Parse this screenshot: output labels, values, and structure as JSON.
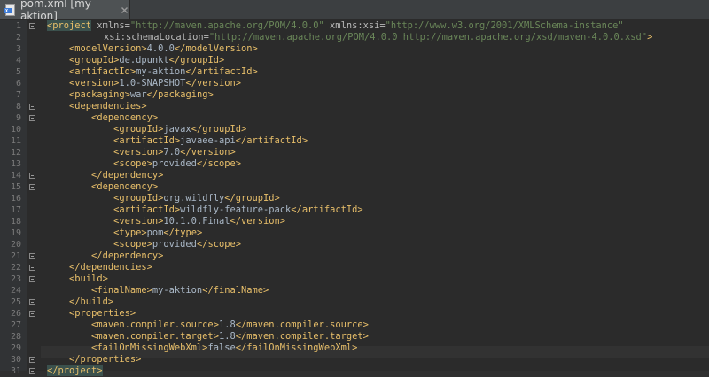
{
  "tab": {
    "title": "pom.xml [my-aktion]",
    "icon": "xml-file-icon"
  },
  "project_open": "<project",
  "project_close": "</project>",
  "xmlns_attr": " xmlns=",
  "xmlns_val": "\"http://maven.apache.org/POM/4.0.0\"",
  "xsi_attr": " xmlns:xsi=",
  "xsi_val": "\"http://www.w3.org/2001/XMLSchema-instance\"",
  "loc_attr": "xsi:schemaLocation=",
  "loc_val": "\"http://maven.apache.org/POM/4.0.0 http://maven.apache.org/xsd/maven-4.0.0.xsd\"",
  "line_numbers": [
    "1",
    "2",
    "3",
    "4",
    "5",
    "6",
    "7",
    "8",
    "9",
    "10",
    "11",
    "12",
    "13",
    "14",
    "15",
    "16",
    "17",
    "18",
    "19",
    "20",
    "21",
    "22",
    "23",
    "24",
    "25",
    "26",
    "27",
    "28",
    "29",
    "30",
    "31"
  ],
  "lines": [
    null,
    null,
    [
      "    ",
      "modelVersion",
      "4.0.0"
    ],
    [
      "    ",
      "groupId",
      "de.dpunkt"
    ],
    [
      "    ",
      "artifactId",
      "my-aktion"
    ],
    [
      "    ",
      "version",
      "1.0-SNAPSHOT"
    ],
    [
      "    ",
      "packaging",
      "war"
    ],
    [
      "    ",
      "dependencies",
      null,
      "open"
    ],
    [
      "        ",
      "dependency",
      null,
      "open"
    ],
    [
      "            ",
      "groupId",
      "javax"
    ],
    [
      "            ",
      "artifactId",
      "javaee-api"
    ],
    [
      "            ",
      "version",
      "7.0"
    ],
    [
      "            ",
      "scope",
      "provided"
    ],
    [
      "        ",
      "dependency",
      null,
      "close"
    ],
    [
      "        ",
      "dependency",
      null,
      "open"
    ],
    [
      "            ",
      "groupId",
      "org.wildfly"
    ],
    [
      "            ",
      "artifactId",
      "wildfly-feature-pack"
    ],
    [
      "            ",
      "version",
      "10.1.0.Final"
    ],
    [
      "            ",
      "type",
      "pom"
    ],
    [
      "            ",
      "scope",
      "provided"
    ],
    [
      "        ",
      "dependency",
      null,
      "close"
    ],
    [
      "    ",
      "dependencies",
      null,
      "close"
    ],
    [
      "    ",
      "build",
      null,
      "open"
    ],
    [
      "        ",
      "finalName",
      "my-aktion"
    ],
    [
      "    ",
      "build",
      null,
      "close"
    ],
    [
      "    ",
      "properties",
      null,
      "open"
    ],
    [
      "        ",
      "maven.compiler.source",
      "1.8"
    ],
    [
      "        ",
      "maven.compiler.target",
      "1.8"
    ],
    [
      "        ",
      "failOnMissingWebXml",
      "false"
    ],
    [
      "    ",
      "properties",
      null,
      "close"
    ],
    null
  ]
}
